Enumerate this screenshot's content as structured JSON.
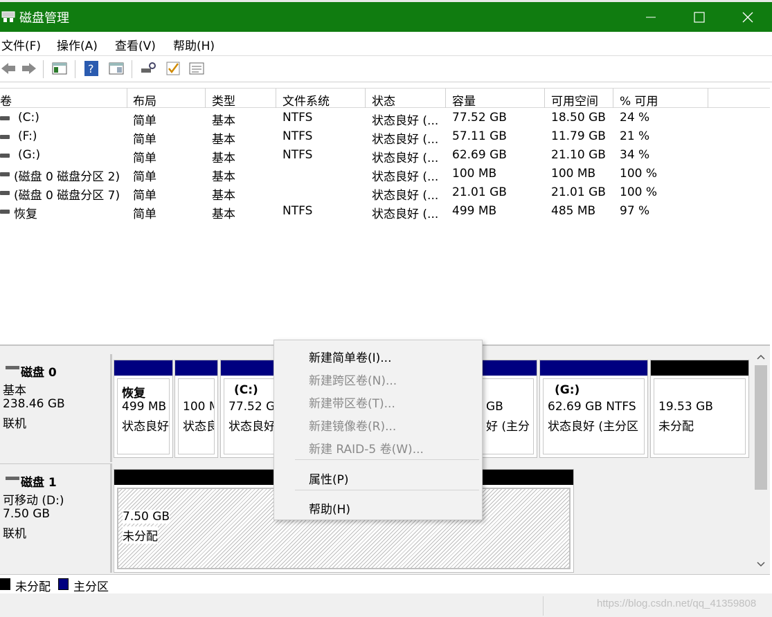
{
  "window": {
    "title": "磁盘管理",
    "colors": {
      "titlebar": "#107c10",
      "primary_partition": "#000080",
      "unallocated": "#000000"
    }
  },
  "menu": [
    {
      "label": "文件(F)"
    },
    {
      "label": "操作(A)"
    },
    {
      "label": "查看(V)"
    },
    {
      "label": "帮助(H)"
    }
  ],
  "toolbar": {
    "icons": [
      "back-arrow-icon",
      "forward-arrow-icon",
      "console-tree-icon",
      "help-icon",
      "show-hide-pane-icon",
      "connect-icon",
      "check-icon",
      "properties-list-icon"
    ]
  },
  "volume_list": {
    "columns": [
      "卷",
      "布局",
      "类型",
      "文件系统",
      "状态",
      "容量",
      "可用空间",
      "% 可用"
    ],
    "rows": [
      [
        "(C:)",
        "简单",
        "基本",
        "NTFS",
        "状态良好 (...",
        "77.52 GB",
        "18.50 GB",
        "24 %"
      ],
      [
        "(F:)",
        "简单",
        "基本",
        "NTFS",
        "状态良好 (...",
        "57.11 GB",
        "11.79 GB",
        "21 %"
      ],
      [
        "(G:)",
        "简单",
        "基本",
        "NTFS",
        "状态良好 (...",
        "62.69 GB",
        "21.10 GB",
        "34 %"
      ],
      [
        "(磁盘 0 磁盘分区 2)",
        "简单",
        "基本",
        "",
        "状态良好 (...",
        "100 MB",
        "100 MB",
        "100 %"
      ],
      [
        "(磁盘 0 磁盘分区 7)",
        "简单",
        "基本",
        "",
        "状态良好 (...",
        "21.01 GB",
        "21.01 GB",
        "100 %"
      ],
      [
        "恢复",
        "简单",
        "基本",
        "NTFS",
        "状态良好 (...",
        "499 MB",
        "485 MB",
        "97 %"
      ]
    ]
  },
  "disks": [
    {
      "name": "磁盘 0",
      "type": "基本",
      "size": "238.46 GB",
      "status": "联机",
      "partitions": [
        {
          "title": "恢复",
          "line1": "499 MB",
          "line2": "状态良好"
        },
        {
          "title": "",
          "line1": "100 M",
          "line2": "状态良"
        },
        {
          "title": "(C:)",
          "line1": "77.52 G",
          "line2": "状态良好"
        },
        {
          "title": "",
          "line1": "GB",
          "line2": "好 (主分"
        },
        {
          "title": "(G:)",
          "line1": "62.69 GB NTFS",
          "line2": "状态良好 (主分区"
        },
        {
          "title": "",
          "line1": "19.53 GB",
          "line2": "未分配"
        }
      ]
    },
    {
      "name": "磁盘 1",
      "type": "可移动 (D:)",
      "size": "7.50 GB",
      "status": "联机",
      "partitions": [
        {
          "title": "",
          "line1": "7.50 GB",
          "line2": "未分配"
        }
      ]
    }
  ],
  "legend": [
    {
      "label": "未分配",
      "color": "#000000"
    },
    {
      "label": "主分区",
      "color": "#000080"
    }
  ],
  "watermark": "https://blog.csdn.net/qq_41359808",
  "context_menu": {
    "items": [
      {
        "label": "新建简单卷(I)...",
        "enabled": true
      },
      {
        "label": "新建跨区卷(N)...",
        "enabled": false
      },
      {
        "label": "新建带区卷(T)...",
        "enabled": false
      },
      {
        "label": "新建镜像卷(R)...",
        "enabled": false
      },
      {
        "label": "新建 RAID-5 卷(W)...",
        "enabled": false
      },
      {
        "label": "属性(P)",
        "enabled": true
      },
      {
        "label": "帮助(H)",
        "enabled": true
      }
    ]
  }
}
